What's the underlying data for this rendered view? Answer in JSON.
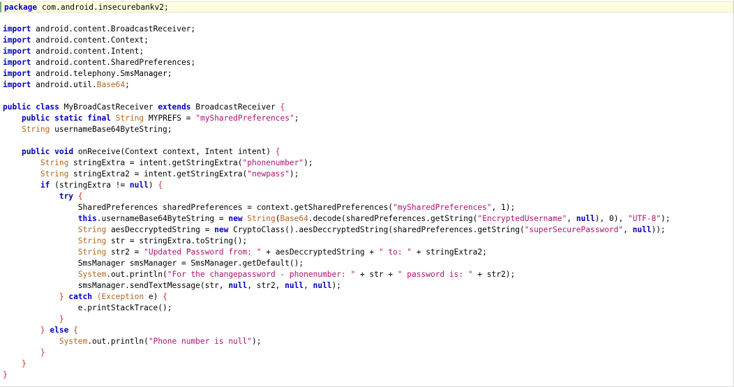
{
  "colors": {
    "keyword": "#0000c0",
    "type": "#b5651d",
    "string": "#b01070",
    "brace": "#d03030",
    "plain": "#000000",
    "current_line_bg": "#ffffe0"
  },
  "current_line": 0,
  "lines": [
    [
      [
        "kw",
        "package"
      ],
      [
        "pl",
        " com.android.insecurebankv2;"
      ]
    ],
    [],
    [
      [
        "kw",
        "import"
      ],
      [
        "pl",
        " android.content.BroadcastReceiver;"
      ]
    ],
    [
      [
        "kw",
        "import"
      ],
      [
        "pl",
        " android.content.Context;"
      ]
    ],
    [
      [
        "kw",
        "import"
      ],
      [
        "pl",
        " android.content.Intent;"
      ]
    ],
    [
      [
        "kw",
        "import"
      ],
      [
        "pl",
        " android.content.SharedPreferences;"
      ]
    ],
    [
      [
        "kw",
        "import"
      ],
      [
        "pl",
        " android.telephony.SmsManager;"
      ]
    ],
    [
      [
        "kw",
        "import"
      ],
      [
        "pl",
        " android.util."
      ],
      [
        "ty",
        "Base64"
      ],
      [
        "pl",
        ";"
      ]
    ],
    [],
    [
      [
        "kw",
        "public"
      ],
      [
        "pl",
        " "
      ],
      [
        "kw",
        "class"
      ],
      [
        "pl",
        " MyBroadCastReceiver "
      ],
      [
        "kw",
        "extends"
      ],
      [
        "pl",
        " BroadcastReceiver "
      ],
      [
        "br",
        "{"
      ]
    ],
    [
      [
        "pl",
        "    "
      ],
      [
        "kw",
        "public"
      ],
      [
        "pl",
        " "
      ],
      [
        "kw",
        "static"
      ],
      [
        "pl",
        " "
      ],
      [
        "kw",
        "final"
      ],
      [
        "pl",
        " "
      ],
      [
        "ty",
        "String"
      ],
      [
        "pl",
        " MYPREFS = "
      ],
      [
        "st",
        "\"mySharedPreferences\""
      ],
      [
        "pl",
        ";"
      ]
    ],
    [
      [
        "pl",
        "    "
      ],
      [
        "ty",
        "String"
      ],
      [
        "pl",
        " usernameBase64ByteString;"
      ]
    ],
    [],
    [
      [
        "pl",
        "    "
      ],
      [
        "kw",
        "public"
      ],
      [
        "pl",
        " "
      ],
      [
        "kw",
        "void"
      ],
      [
        "pl",
        " onReceive(Context context, Intent intent) "
      ],
      [
        "br",
        "{"
      ]
    ],
    [
      [
        "pl",
        "        "
      ],
      [
        "ty",
        "String"
      ],
      [
        "pl",
        " stringExtra = intent.getStringExtra("
      ],
      [
        "st",
        "\"phonenumber\""
      ],
      [
        "pl",
        ");"
      ]
    ],
    [
      [
        "pl",
        "        "
      ],
      [
        "ty",
        "String"
      ],
      [
        "pl",
        " stringExtra2 = intent.getStringExtra("
      ],
      [
        "st",
        "\"newpass\""
      ],
      [
        "pl",
        ");"
      ]
    ],
    [
      [
        "pl",
        "        "
      ],
      [
        "kw",
        "if"
      ],
      [
        "pl",
        " (stringExtra != "
      ],
      [
        "kw",
        "null"
      ],
      [
        "pl",
        ") "
      ],
      [
        "br",
        "{"
      ]
    ],
    [
      [
        "pl",
        "            "
      ],
      [
        "kw",
        "try"
      ],
      [
        "pl",
        " "
      ],
      [
        "br",
        "{"
      ]
    ],
    [
      [
        "pl",
        "                SharedPreferences sharedPreferences = context.getSharedPreferences("
      ],
      [
        "st",
        "\"mySharedPreferences\""
      ],
      [
        "pl",
        ", 1);"
      ]
    ],
    [
      [
        "pl",
        "                "
      ],
      [
        "kw",
        "this"
      ],
      [
        "pl",
        ".usernameBase64ByteString = "
      ],
      [
        "kw",
        "new"
      ],
      [
        "pl",
        " "
      ],
      [
        "ty",
        "String"
      ],
      [
        "pl",
        "("
      ],
      [
        "ty",
        "Base64"
      ],
      [
        "pl",
        ".decode(sharedPreferences.getString("
      ],
      [
        "st",
        "\"EncryptedUsername\""
      ],
      [
        "pl",
        ", "
      ],
      [
        "kw",
        "null"
      ],
      [
        "pl",
        "), 0), "
      ],
      [
        "st",
        "\"UTF-8\""
      ],
      [
        "pl",
        ");"
      ]
    ],
    [
      [
        "pl",
        "                "
      ],
      [
        "ty",
        "String"
      ],
      [
        "pl",
        " aesDeccryptedString = "
      ],
      [
        "kw",
        "new"
      ],
      [
        "pl",
        " CryptoClass().aesDeccryptedString(sharedPreferences.getString("
      ],
      [
        "st",
        "\"superSecurePassword\""
      ],
      [
        "pl",
        ", "
      ],
      [
        "kw",
        "null"
      ],
      [
        "pl",
        "));"
      ]
    ],
    [
      [
        "pl",
        "                "
      ],
      [
        "ty",
        "String"
      ],
      [
        "pl",
        " str = stringExtra.toString();"
      ]
    ],
    [
      [
        "pl",
        "                "
      ],
      [
        "ty",
        "String"
      ],
      [
        "pl",
        " str2 = "
      ],
      [
        "st",
        "\"Updated Password from: \""
      ],
      [
        "pl",
        " + aesDeccryptedString + "
      ],
      [
        "st",
        "\" to: \""
      ],
      [
        "pl",
        " + stringExtra2;"
      ]
    ],
    [
      [
        "pl",
        "                SmsManager smsManager = SmsManager.getDefault();"
      ]
    ],
    [
      [
        "pl",
        "                "
      ],
      [
        "ty",
        "System"
      ],
      [
        "pl",
        ".out.println("
      ],
      [
        "st",
        "\"For the changepassword - phonenumber: \""
      ],
      [
        "pl",
        " + str + "
      ],
      [
        "st",
        "\" password is: \""
      ],
      [
        "pl",
        " + str2);"
      ]
    ],
    [
      [
        "pl",
        "                smsManager.sendTextMessage(str, "
      ],
      [
        "kw",
        "null"
      ],
      [
        "pl",
        ", str2, "
      ],
      [
        "kw",
        "null"
      ],
      [
        "pl",
        ", "
      ],
      [
        "kw",
        "null"
      ],
      [
        "pl",
        ");"
      ]
    ],
    [
      [
        "pl",
        "            "
      ],
      [
        "br",
        "}"
      ],
      [
        "pl",
        " "
      ],
      [
        "kw",
        "catch"
      ],
      [
        "pl",
        " "
      ],
      [
        "ty",
        "(Exception"
      ],
      [
        "pl",
        " e) "
      ],
      [
        "br",
        "{"
      ]
    ],
    [
      [
        "pl",
        "                e.printStackTrace();"
      ]
    ],
    [
      [
        "pl",
        "            "
      ],
      [
        "br",
        "}"
      ]
    ],
    [
      [
        "pl",
        "        "
      ],
      [
        "br",
        "}"
      ],
      [
        "pl",
        " "
      ],
      [
        "kw",
        "else"
      ],
      [
        "pl",
        " "
      ],
      [
        "br",
        "{"
      ]
    ],
    [
      [
        "pl",
        "            "
      ],
      [
        "ty",
        "System"
      ],
      [
        "pl",
        ".out.println("
      ],
      [
        "st",
        "\"Phone number is null\""
      ],
      [
        "pl",
        ");"
      ]
    ],
    [
      [
        "pl",
        "        "
      ],
      [
        "br",
        "}"
      ]
    ],
    [
      [
        "pl",
        "    "
      ],
      [
        "br",
        "}"
      ]
    ],
    [
      [
        "br",
        "}"
      ]
    ]
  ]
}
